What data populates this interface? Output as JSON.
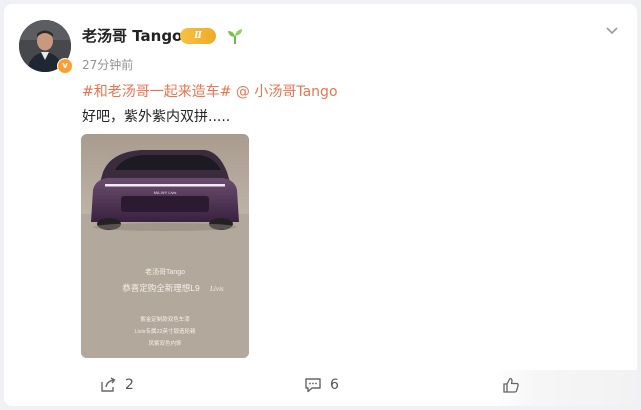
{
  "post": {
    "author": "老汤哥 Tango",
    "level_badge": "Ⅱ",
    "verified_mark": "v",
    "timestamp": "27分钟前",
    "topic": "#和老汤哥一起来造车#",
    "mention": "@ 小汤哥Tango",
    "text": "好吧，紫外紫内双拼.....",
    "image": {
      "caption_brand": "老汤哥Tango",
      "caption_title": "恭喜定购全新理想L9 ",
      "caption_title_logo": "Livis",
      "caption_line1": "紫金定制款双色车漆",
      "caption_line2": "Livis专属22英寸锻造轮毂",
      "caption_line3": "凤紫双色内饰",
      "plate_text": "MA-WY Livis"
    }
  },
  "actions": {
    "share_count": "2",
    "comment_count": "6",
    "like_count": ""
  },
  "icons": {
    "more": "chevron-down-icon",
    "share": "share-icon",
    "comment": "comment-icon",
    "like": "thumbs-up-icon",
    "sprout": "sprout-icon"
  },
  "colors": {
    "link": "#eb7350",
    "badge": "#f0a928",
    "verified": "#ff9e2c"
  }
}
